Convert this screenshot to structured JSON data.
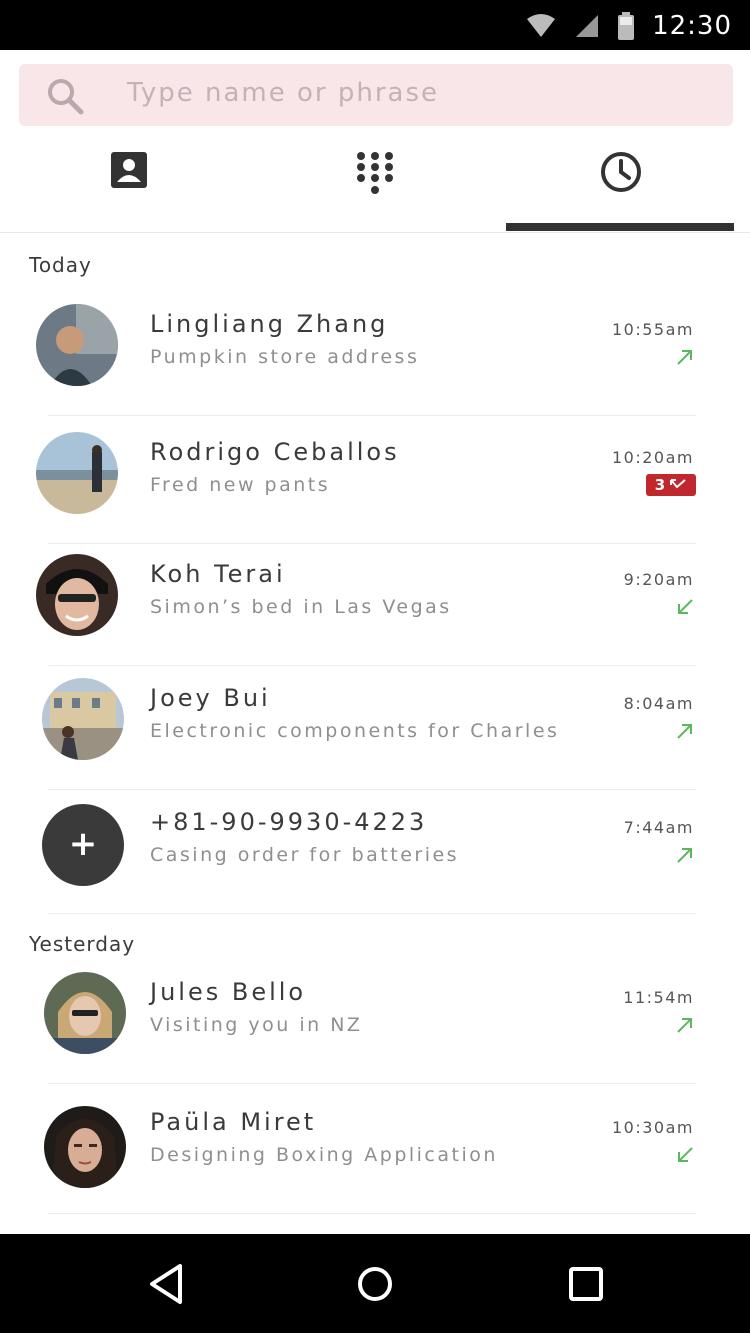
{
  "status_bar": {
    "time": "12:30"
  },
  "search": {
    "placeholder": "Type name or phrase"
  },
  "tabs": [
    {
      "name": "contacts",
      "icon": "contact-card-icon",
      "active": false
    },
    {
      "name": "dialpad",
      "icon": "dialpad-icon",
      "active": false
    },
    {
      "name": "recents",
      "icon": "clock-icon",
      "active": true
    }
  ],
  "sections": {
    "today": "Today",
    "yesterday": "Yesterday"
  },
  "calls": [
    {
      "name": "Lingliang Zhang",
      "subject": "Pumpkin store address",
      "time": "10:55am",
      "direction": "outgoing"
    },
    {
      "name": "Rodrigo Ceballos",
      "subject": "Fred new pants",
      "time": "10:20am",
      "direction": "missed",
      "missed_count": "3"
    },
    {
      "name": "Koh Terai",
      "subject": "Simon’s bed in Las Vegas",
      "time": "9:20am",
      "direction": "incoming"
    },
    {
      "name": "Joey Bui",
      "subject": "Electronic components for Charles",
      "time": "8:04am",
      "direction": "outgoing"
    },
    {
      "name": "+81-90-9930-4223",
      "subject": "Casing order for batteries",
      "time": "7:44am",
      "direction": "outgoing"
    },
    {
      "name": "Jules Bello",
      "subject": "Visiting you in NZ",
      "time": "11:54m",
      "direction": "outgoing"
    },
    {
      "name": "Paüla Miret",
      "subject": "Designing Boxing Application",
      "time": "10:30am",
      "direction": "incoming"
    }
  ],
  "add_contact_symbol": "+",
  "colors": {
    "accent_bar": "#323232",
    "search_bg": "#f8e6e9",
    "direction_green": "#5cb85c",
    "missed_red": "#c0282e"
  }
}
